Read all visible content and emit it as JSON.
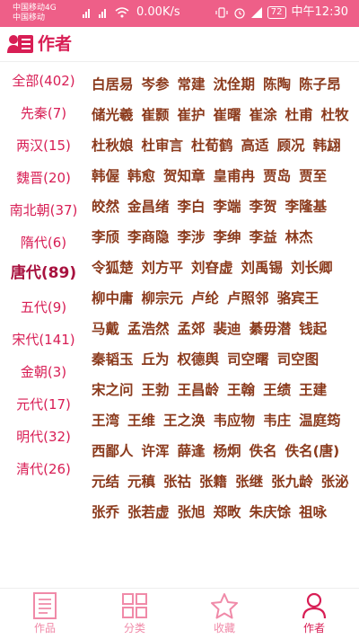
{
  "status_bar": {
    "carrier_line1": "中国移动4G",
    "carrier_line2": "中国移动",
    "network_speed": "0.00K/s",
    "battery": "72",
    "time": "中午12:30"
  },
  "header": {
    "title": "作者",
    "icon": "author-card-icon"
  },
  "colors": {
    "accent": "#d81e55",
    "statusbar": "#ee5f88",
    "poet_text": "#8b3a1c",
    "inactive_tab": "#f08aa8"
  },
  "dynasties": [
    {
      "label": "全部(402)"
    },
    {
      "label": "先秦(7)"
    },
    {
      "label": "两汉(15)"
    },
    {
      "label": "魏晋(20)"
    },
    {
      "label": "南北朝(37)"
    },
    {
      "label": "隋代(6)"
    },
    {
      "label": "唐代(89)"
    },
    {
      "label": "五代(9)"
    },
    {
      "label": "宋代(141)"
    },
    {
      "label": "金朝(3)"
    },
    {
      "label": "元代(17)"
    },
    {
      "label": "明代(32)"
    },
    {
      "label": "清代(26)"
    }
  ],
  "selected_dynasty": "唐代(89)",
  "poet_rows": [
    [
      "白居易",
      "岑参",
      "常建",
      "沈佺期",
      "陈陶",
      "陈子昂"
    ],
    [
      "储光羲",
      "崔颢",
      "崔护",
      "崔曙",
      "崔涂",
      "杜甫",
      "杜牧"
    ],
    [
      "杜秋娘",
      "杜审言",
      "杜荀鹤",
      "高适",
      "顾况",
      "韩翃"
    ],
    [
      "韩偓",
      "韩愈",
      "贺知章",
      "皇甫冉",
      "贾岛",
      "贾至"
    ],
    [
      "皎然",
      "金昌绪",
      "李白",
      "李端",
      "李贺",
      "李隆基"
    ],
    [
      "李颀",
      "李商隐",
      "李涉",
      "李绅",
      "李益",
      "林杰"
    ],
    [
      "令狐楚",
      "刘方平",
      "刘昚虚",
      "刘禹锡",
      "刘长卿"
    ],
    [
      "柳中庸",
      "柳宗元",
      "卢纶",
      "卢照邻",
      "骆宾王"
    ],
    [
      "马戴",
      "孟浩然",
      "孟郊",
      "裴迪",
      "綦毋潜",
      "钱起"
    ],
    [
      "秦韬玉",
      "丘为",
      "权德舆",
      "司空曙",
      "司空图"
    ],
    [
      "宋之问",
      "王勃",
      "王昌龄",
      "王翰",
      "王绩",
      "王建"
    ],
    [
      "王湾",
      "王维",
      "王之涣",
      "韦应物",
      "韦庄",
      "温庭筠"
    ],
    [
      "西鄙人",
      "许浑",
      "薛逢",
      "杨炯",
      "佚名",
      "佚名(唐)"
    ],
    [
      "元结",
      "元稹",
      "张祜",
      "张籍",
      "张继",
      "张九龄",
      "张泌"
    ],
    [
      "张乔",
      "张若虚",
      "张旭",
      "郑畋",
      "朱庆馀",
      "祖咏"
    ]
  ],
  "bottom_nav": [
    {
      "label": "作品",
      "icon": "document-icon",
      "active": false
    },
    {
      "label": "分类",
      "icon": "grid-icon",
      "active": false
    },
    {
      "label": "收藏",
      "icon": "star-icon",
      "active": false
    },
    {
      "label": "作者",
      "icon": "person-icon",
      "active": true
    }
  ]
}
